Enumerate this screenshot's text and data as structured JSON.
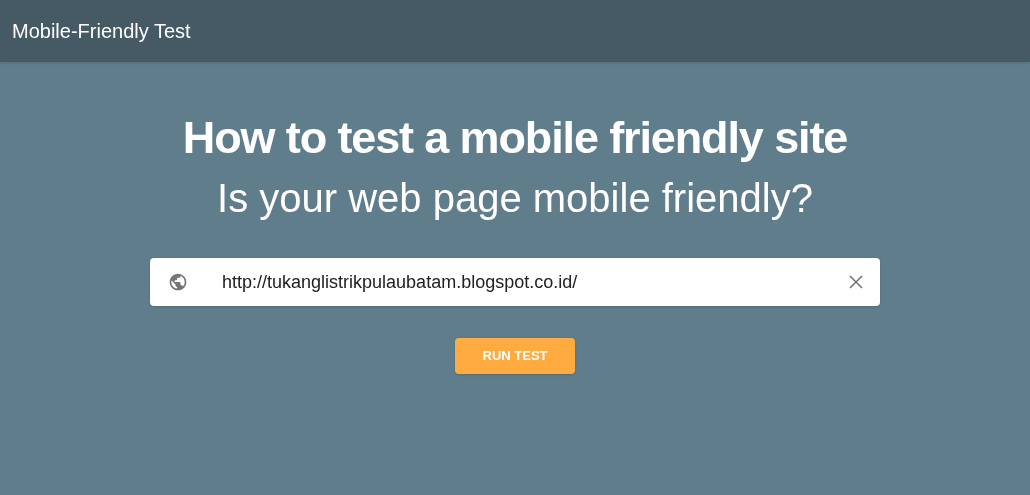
{
  "header": {
    "title": "Mobile-Friendly Test"
  },
  "headline": "How to test a mobile friendly site",
  "subtitle": "Is your web page mobile friendly?",
  "url_field": {
    "value": "http://tukanglistrikpulaubatam.blogspot.co.id/"
  },
  "button": "RUN TEST"
}
